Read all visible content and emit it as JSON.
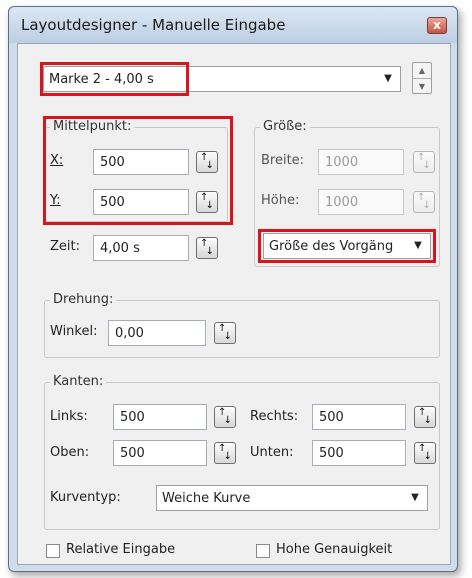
{
  "window": {
    "title": "Layoutdesigner - Manuelle Eingabe",
    "close_glyph": "x"
  },
  "marker": {
    "value": "Marke 2 - 4,00 s",
    "dropdown_icon": "chevron-down-icon",
    "spin_icon": "up-down-spinner-icon"
  },
  "mittelpunkt": {
    "label": "Mittelpunkt:",
    "x_label": "X:",
    "x_value": "500",
    "y_label": "Y:",
    "y_value": "500"
  },
  "zeit": {
    "label": "Zeit:",
    "value": "4,00 s"
  },
  "groesse": {
    "label": "Größe:",
    "breite_label": "Breite:",
    "breite_value": "1000",
    "hoehe_label": "Höhe:",
    "hoehe_value": "1000",
    "mode_value": "Größe des Vorgäng"
  },
  "drehung": {
    "label": "Drehung:",
    "winkel_label": "Winkel:",
    "winkel_value": "0,00"
  },
  "kanten": {
    "label": "Kanten:",
    "links_label": "Links:",
    "links_value": "500",
    "rechts_label": "Rechts:",
    "rechts_value": "500",
    "oben_label": "Oben:",
    "oben_value": "500",
    "unten_label": "Unten:",
    "unten_value": "500",
    "kurventyp_label": "Kurventyp:",
    "kurventyp_value": "Weiche Kurve"
  },
  "options": {
    "relative_label": "Relative Eingabe",
    "relative_checked": false,
    "genauigkeit_label": "Hohe Genauigkeit",
    "genauigkeit_checked": false
  },
  "colors": {
    "highlight": "#d9141b",
    "window_frame": "#cfdcea",
    "client_bg": "#f0f0f0"
  }
}
